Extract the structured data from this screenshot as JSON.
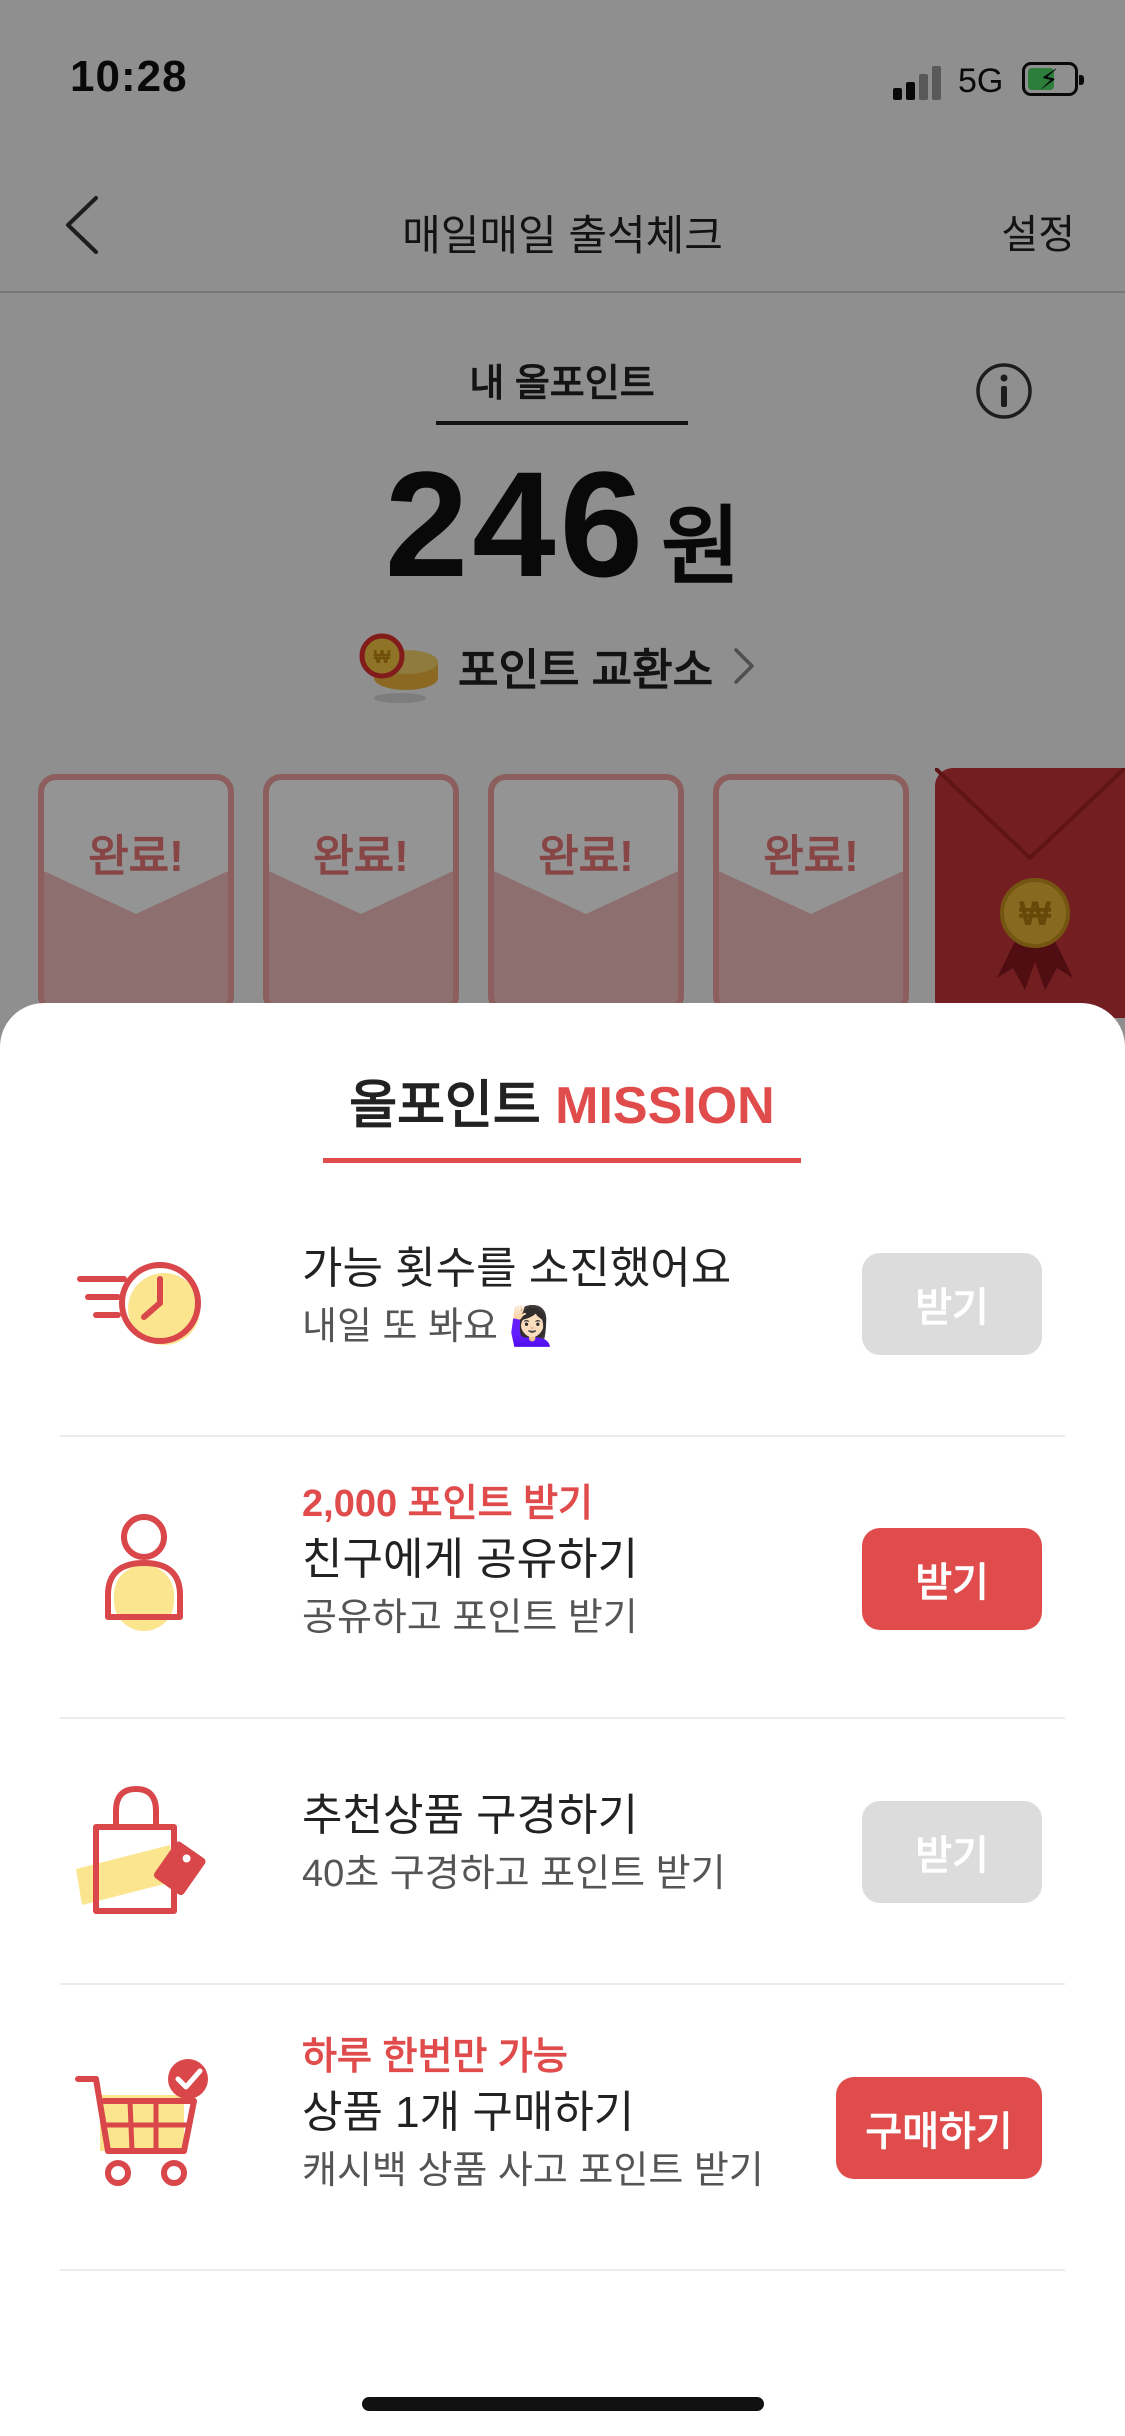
{
  "status": {
    "time": "10:28",
    "network": "5G"
  },
  "nav": {
    "title": "매일매일 출석체크",
    "settings": "설정"
  },
  "points": {
    "label": "내 올포인트",
    "value": "246",
    "unit": "원"
  },
  "exchange": {
    "label": "포인트 교환소"
  },
  "envelopes": [
    {
      "label": "완료!"
    },
    {
      "label": "완료!"
    },
    {
      "label": "완료!"
    },
    {
      "label": "완료!"
    }
  ],
  "sheet": {
    "title_main": "올포인트",
    "title_accent": "MISSION"
  },
  "missions": [
    {
      "highlight": "",
      "title": "가능 횟수를 소진했어요",
      "subtitle": "내일 또 봐요 🙋🏻‍♀️",
      "button": "받기",
      "enabled": false
    },
    {
      "highlight": "2,000 포인트 받기",
      "title": "친구에게 공유하기",
      "subtitle": "공유하고 포인트 받기",
      "button": "받기",
      "enabled": true
    },
    {
      "highlight": "",
      "title": "추천상품 구경하기",
      "subtitle": "40초 구경하고 포인트 받기",
      "button": "받기",
      "enabled": false
    },
    {
      "highlight": "하루 한번만 가능",
      "title": "상품 1개 구매하기",
      "subtitle": "캐시백 상품 사고 포인트 받기",
      "button": "구매하기",
      "enabled": true
    }
  ],
  "colors": {
    "accent": "#e04b4b",
    "disabled_button": "#dcdcdc",
    "icon_yellow": "#fbe58f"
  },
  "icons": [
    "chevron-left-icon",
    "info-icon",
    "coin-exchange-icon",
    "chevron-right-icon",
    "clock-speed-icon",
    "person-icon",
    "shopping-bag-icon",
    "cart-icon"
  ]
}
